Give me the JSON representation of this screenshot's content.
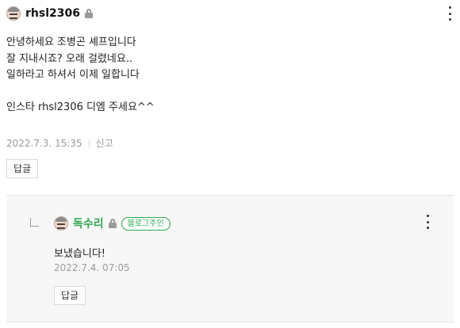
{
  "comment": {
    "author": "rhsl2306",
    "lines": [
      "안녕하세요 조병곤 셰프입니다",
      "잘 지내시죠? 오래 걸렸네요..",
      "일하라고 하셔서 이제 일합니다",
      "",
      "인스타 rhsl2306 디엠 주세요^^"
    ],
    "date": "2022.7.3. 15:35",
    "report_label": "신고",
    "reply_label": "답글"
  },
  "reply": {
    "author": "독수리",
    "badge": "블로그주인",
    "text": "보냈습니다!",
    "date": "2022.7.4. 07:05",
    "reply_label": "답글"
  },
  "colors": {
    "owner_green": "#2fa84f",
    "meta_gray": "#9a9a9a",
    "reply_bg": "#f7f7f7"
  },
  "icons": [
    "avatar-icon",
    "lock-icon",
    "more-icon",
    "reply-arrow-icon"
  ]
}
